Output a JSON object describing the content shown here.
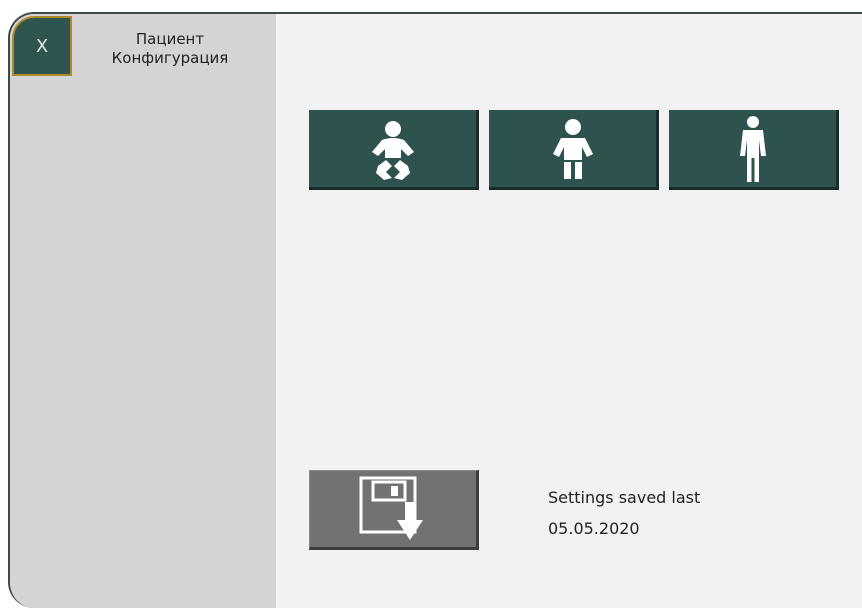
{
  "header": {
    "close_label": "X",
    "title_line1": "Пациент",
    "title_line2": "Конфигурация"
  },
  "patient_types": [
    {
      "icon": "infant-icon"
    },
    {
      "icon": "child-icon"
    },
    {
      "icon": "adult-icon"
    }
  ],
  "save": {
    "icon": "save-floppy-icon",
    "status_label": "Settings saved last",
    "status_date": "05.05.2020"
  },
  "colors": {
    "accent": "#2e524e",
    "close_border": "#b08a2a",
    "sidebar": "#d3d4d3",
    "save_button": "#727272"
  }
}
